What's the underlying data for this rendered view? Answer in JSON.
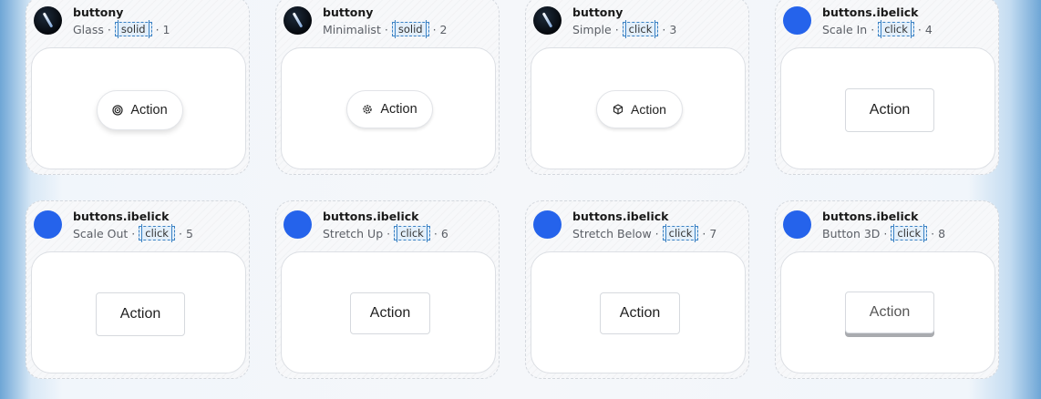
{
  "cards": [
    {
      "author": "buttony",
      "style": "Glass",
      "tag": "solid",
      "index": "1",
      "button_label": "Action",
      "button_icon": "target-icon"
    },
    {
      "author": "buttony",
      "style": "Minimalist",
      "tag": "solid",
      "index": "2",
      "button_label": "Action",
      "button_icon": "gear-icon"
    },
    {
      "author": "buttony",
      "style": "Simple",
      "tag": "click",
      "index": "3",
      "button_label": "Action",
      "button_icon": "cube-icon"
    },
    {
      "author": "buttons.ibelick",
      "style": "Scale In",
      "tag": "click",
      "index": "4",
      "button_label": "Action"
    },
    {
      "author": "buttons.ibelick",
      "style": "Scale Out",
      "tag": "click",
      "index": "5",
      "button_label": "Action"
    },
    {
      "author": "buttons.ibelick",
      "style": "Stretch Up",
      "tag": "click",
      "index": "6",
      "button_label": "Action"
    },
    {
      "author": "buttons.ibelick",
      "style": "Stretch Below",
      "tag": "click",
      "index": "7",
      "button_label": "Action"
    },
    {
      "author": "buttons.ibelick",
      "style": "Button 3D",
      "tag": "click",
      "index": "8",
      "button_label": "Action"
    }
  ],
  "colors": {
    "accent_blue": "#2563eb",
    "tag_border": "#3b82c4",
    "tag_bg": "#e3effa"
  }
}
